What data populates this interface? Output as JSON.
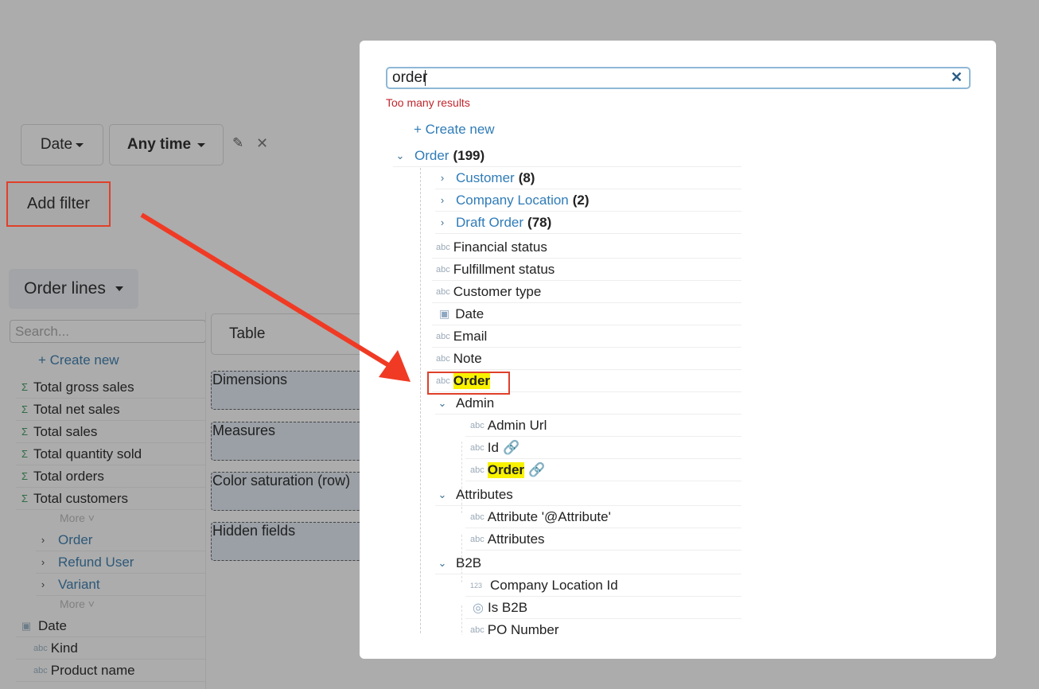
{
  "filters": {
    "field": "Date",
    "range": "Any time",
    "add_filter": "Add filter"
  },
  "source": {
    "label": "Order lines",
    "search_placeholder": "Search...",
    "create_new": "+ Create new",
    "measures": [
      "Total gross sales",
      "Total net sales",
      "Total sales",
      "Total quantity sold",
      "Total orders",
      "Total customers"
    ],
    "more": "More",
    "relations": [
      "Order",
      "Refund User",
      "Variant"
    ],
    "fields": [
      {
        "icon": "calendar-icon",
        "label": "Date"
      },
      {
        "icon": "abc",
        "label": "Kind"
      },
      {
        "icon": "abc",
        "label": "Product name"
      }
    ]
  },
  "viz": {
    "type": "Table",
    "zones": [
      "Dimensions",
      "Measures",
      "Color saturation (row)",
      "Hidden fields"
    ]
  },
  "modal": {
    "search_value": "order",
    "error": "Too many results",
    "create_new": "+ Create new",
    "root": {
      "label": "Order",
      "count": "(199)"
    },
    "relations": [
      {
        "label": "Customer",
        "count": "(8)"
      },
      {
        "label": "Company Location",
        "count": "(2)"
      },
      {
        "label": "Draft Order",
        "count": "(78)"
      }
    ],
    "fields": [
      "Financial status",
      "Fulfillment status",
      "Customer type",
      "Date",
      "Email",
      "Note",
      "Order"
    ],
    "groups": [
      {
        "label": "Admin",
        "items": [
          "Admin Url",
          "Id",
          "Order"
        ]
      },
      {
        "label": "Attributes",
        "items": [
          "Attribute '@Attribute'",
          "Attributes"
        ]
      },
      {
        "label": "B2B",
        "items": [
          "Company Location Id",
          "Is B2B",
          "PO Number"
        ]
      }
    ],
    "type_abc": "abc",
    "type_num": "123"
  },
  "colors": {
    "accent": "#2f7cb8",
    "error": "#c0262d",
    "highlight": "#f8f200",
    "annotation": "#f03a24"
  }
}
